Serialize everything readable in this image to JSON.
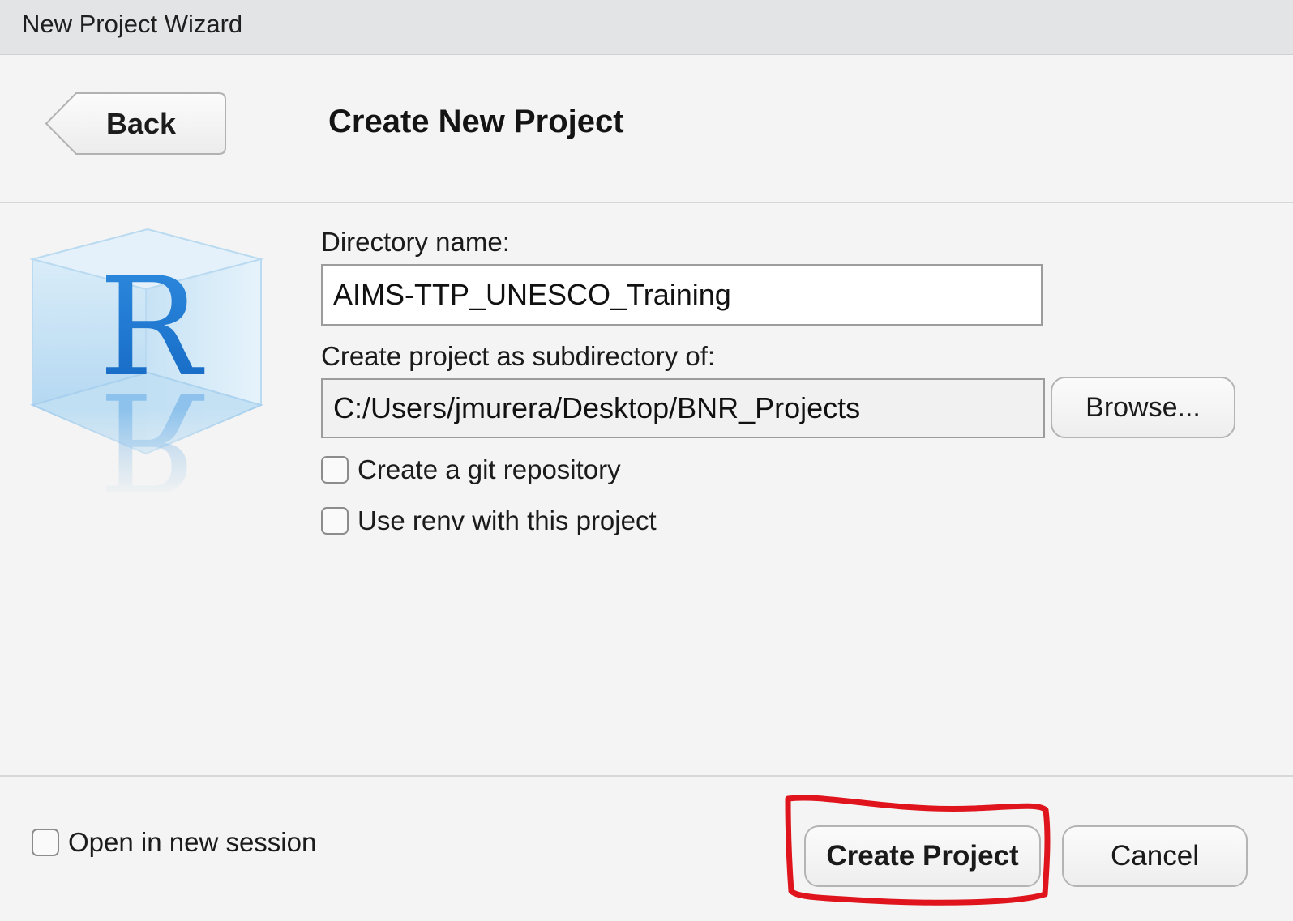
{
  "window": {
    "title": "New Project Wizard"
  },
  "header": {
    "back_label": "Back",
    "page_title": "Create New Project"
  },
  "form": {
    "directory_name_label": "Directory name:",
    "directory_name_value": "AIMS-TTP_UNESCO_Training",
    "subdirectory_label": "Create project as subdirectory of:",
    "subdirectory_value": "C:/Users/jmurera/Desktop/BNR_Projects",
    "browse_label": "Browse...",
    "git_checkbox_label": "Create a git repository",
    "git_checked": false,
    "renv_checkbox_label": "Use renv with this project",
    "renv_checked": false
  },
  "footer": {
    "new_session_label": "Open in new session",
    "new_session_checked": false,
    "create_label": "Create Project",
    "cancel_label": "Cancel"
  },
  "logo": {
    "letter": "R",
    "icon": "r-cube-logo"
  },
  "annotation": {
    "highlight_color": "#e0141c",
    "target": "create-project-button"
  },
  "colors": {
    "titlebar": "#e3e4e6",
    "background": "#f3f4f3",
    "r_blue": "#1a7ad4"
  }
}
